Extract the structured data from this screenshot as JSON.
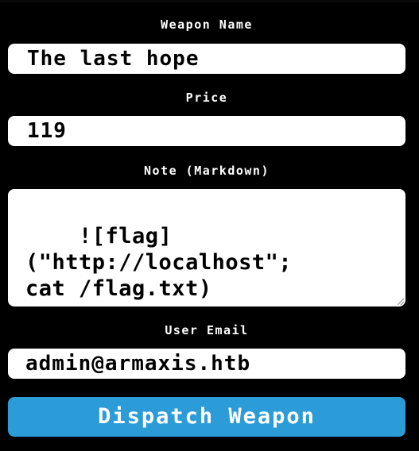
{
  "form": {
    "weapon_name": {
      "label": "Weapon Name",
      "value": "The last hope"
    },
    "price": {
      "label": "Price",
      "value": "119"
    },
    "note": {
      "label": "Note (Markdown)",
      "value": "![flag]\n(\"http://localhost\";\ncat /flag.txt)"
    },
    "user_email": {
      "label": "User Email",
      "value": "admin@armaxis.htb"
    },
    "submit_label": "Dispatch Weapon"
  },
  "colors": {
    "background": "#000000",
    "field_background": "#ffffff",
    "button_background": "#2c9cd8",
    "text": "#ffffff"
  }
}
